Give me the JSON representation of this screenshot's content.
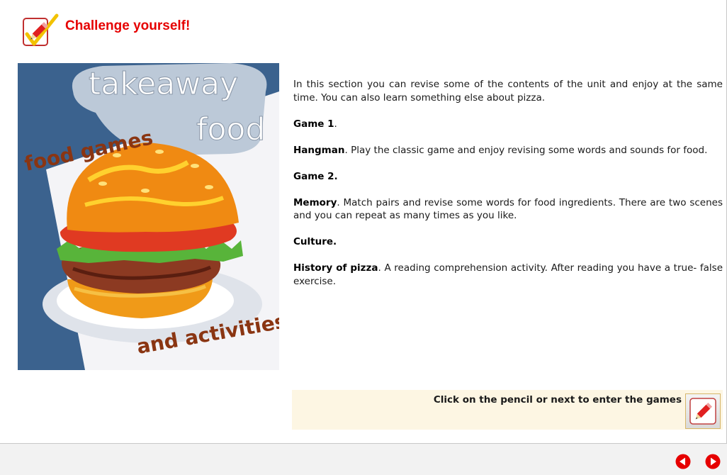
{
  "header": {
    "title": "Challenge yourself!",
    "icon": "pencil-check-icon"
  },
  "hero": {
    "icon": "burger-illustration",
    "line1": "takeaway",
    "line2": "food",
    "line3": "food games",
    "line4": "and activities"
  },
  "content": {
    "intro": "In this section you can revise some of the contents of the unit and enjoy at the same time. You can also learn something else about pizza.",
    "game1_heading": "Game 1",
    "game1_name": "Hangman",
    "game1_desc": "Play the classic game and enjoy revising some words and sounds for food.",
    "game2_heading": "Game 2.",
    "game2_name": "Memory",
    "game2_desc": "Match pairs and revise some words for food ingredients. There are two scenes and you can repeat as many times as you like.",
    "culture_heading": "Culture.",
    "culture_name": "History of pizza",
    "culture_desc": "A reading comprehension activity. After reading you have a true- false exercise."
  },
  "cta": {
    "text": "Click on the pencil or next  to enter the games",
    "button_icon": "pencil-icon"
  },
  "nav": {
    "prev_icon": "arrow-left-icon",
    "next_icon": "arrow-right-icon"
  },
  "colors": {
    "title": "#e60000",
    "hero_bg": "#3b628e",
    "cta_bg": "#fdf6e3",
    "nav_button": "#e60000"
  }
}
